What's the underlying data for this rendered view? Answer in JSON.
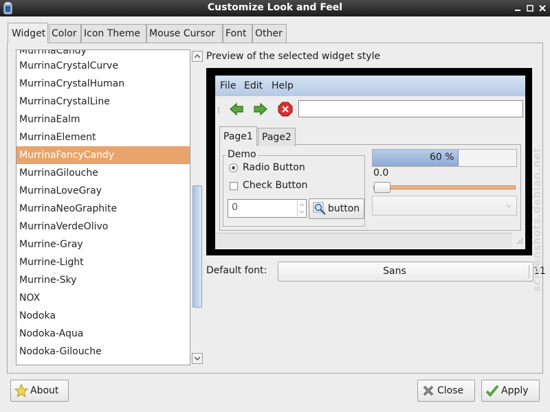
{
  "window": {
    "title": "Customize Look and Feel"
  },
  "tabs": [
    {
      "label": "Widget"
    },
    {
      "label": "Color"
    },
    {
      "label": "Icon Theme"
    },
    {
      "label": "Mouse Cursor"
    },
    {
      "label": "Font"
    },
    {
      "label": "Other"
    }
  ],
  "theme_list": {
    "items": [
      {
        "label": "MurrinaCrystalCurve"
      },
      {
        "label": "MurrinaCrystalHuman"
      },
      {
        "label": "MurrinaCrystalLine"
      },
      {
        "label": "MurrinaEalm"
      },
      {
        "label": "MurrinaElement"
      },
      {
        "label": "MurrinaFancyCandy"
      },
      {
        "label": "MurrinaGilouche"
      },
      {
        "label": "MurrinaLoveGray"
      },
      {
        "label": "MurrinaNeoGraphite"
      },
      {
        "label": "MurrinaVerdeOlivo"
      },
      {
        "label": "Murrine-Gray"
      },
      {
        "label": "Murrine-Light"
      },
      {
        "label": "Murrine-Sky"
      },
      {
        "label": "NOX"
      },
      {
        "label": "Nodoka"
      },
      {
        "label": "Nodoka-Aqua"
      },
      {
        "label": "Nodoka-Gilouche"
      }
    ],
    "selected": "MurrinaFancyCandy"
  },
  "preview": {
    "label": "Preview of the selected widget style",
    "menu": [
      "File",
      "Edit",
      "Help"
    ],
    "notebook_tabs": [
      "Page1",
      "Page2"
    ],
    "frame_label": "Demo",
    "radio_label": "Radio Button",
    "check_label": "Check Button",
    "spin_value": "0",
    "button_label": "button",
    "progress": {
      "fraction": 0.6,
      "text": "60 %"
    },
    "scale_value": "0.0"
  },
  "default_font": {
    "label": "Default font:",
    "name": "Sans",
    "size": "11"
  },
  "buttons": {
    "about": "About",
    "close": "Close",
    "apply": "Apply"
  },
  "watermark": "screenshots.debian.net",
  "colors": {
    "selection": "#e8a46a",
    "titlebar": "#2a2a2a",
    "menubar": "#c5d6ec"
  }
}
